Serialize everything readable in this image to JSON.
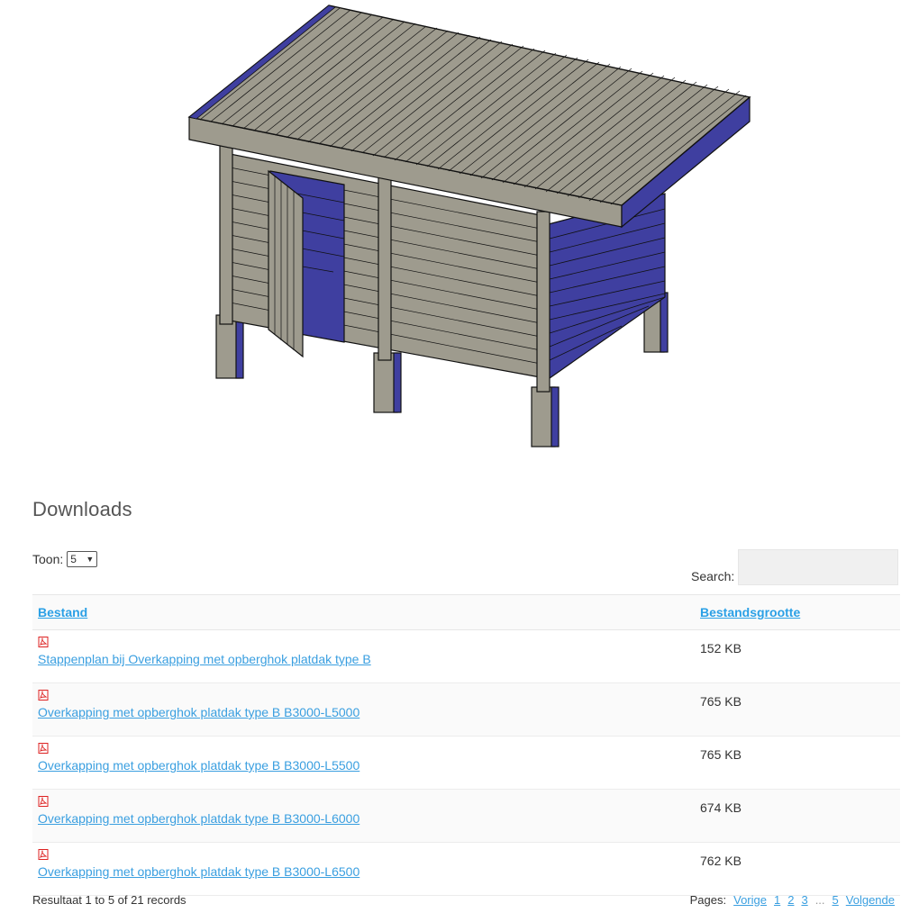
{
  "downloads": {
    "title": "Downloads",
    "toon_label": "Toon:",
    "toon_value": "5",
    "search_label": "Search:",
    "search_value": "",
    "columns": {
      "file": "Bestand",
      "size": "Bestandsgrootte"
    },
    "rows": [
      {
        "name": "Stappenplan bij Overkapping met opberghok platdak type B",
        "size": "152 KB",
        "icon": "pdf-icon"
      },
      {
        "name": "Overkapping met opberghok platdak type B B3000-L5000",
        "size": "765 KB",
        "icon": "pdf-icon"
      },
      {
        "name": "Overkapping met opberghok platdak type B B3000-L5500",
        "size": "765 KB",
        "icon": "pdf-icon"
      },
      {
        "name": "Overkapping met opberghok platdak type B B3000-L6000",
        "size": "674 KB",
        "icon": "pdf-icon"
      },
      {
        "name": "Overkapping met opberghok platdak type B B3000-L6500",
        "size": "762 KB",
        "icon": "pdf-icon"
      }
    ],
    "result_text": "Resultaat 1 to 5 of 21 records",
    "pager": {
      "label": "Pages:",
      "prev": "Vorige",
      "p1": "1",
      "p2": "2",
      "p3": "3",
      "dots": "...",
      "p5": "5",
      "next": "Volgende"
    }
  },
  "colors": {
    "link": "#3a9fe0",
    "wood": "#9e9b8e",
    "shade": "#3f3fa0"
  }
}
